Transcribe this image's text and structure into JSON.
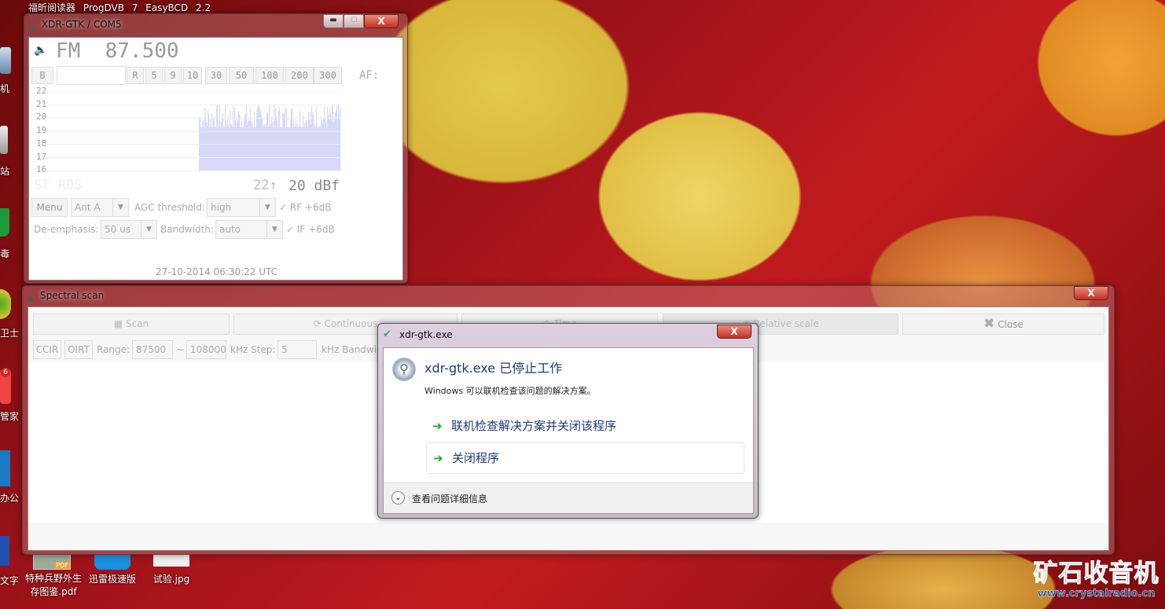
{
  "taskbar": {
    "items": [
      "福昕阅读器",
      "ProgDVB 7",
      "EasyBCD 2.2"
    ]
  },
  "desktop": {
    "left_labels": [
      "机",
      "站",
      "毒",
      "卫士",
      "管家",
      "办公",
      "文字"
    ],
    "badge": "6",
    "bottom_icons": [
      {
        "label1": "特种兵野外生",
        "label2": "存图鉴.pdf",
        "badge": "PDF"
      },
      {
        "label1": "迅雷极速版"
      },
      {
        "label1": "试验.jpg"
      }
    ],
    "watermark": {
      "title": "矿石收音机",
      "url": "www.crystalradio.cn"
    }
  },
  "xdr": {
    "title": "XDR-GTK / COM5",
    "freq": "FM  87.500",
    "buttons": [
      "B",
      "R",
      "5",
      "9",
      "10",
      "30",
      "50",
      "100",
      "200",
      "300"
    ],
    "af_label": "AF:",
    "y_ticks": [
      "22",
      "21",
      "20",
      "19",
      "18",
      "17",
      "16"
    ],
    "st_rds": "ST RDS",
    "signal_peak": "22↑",
    "signal": "20 dBf",
    "menu": "Menu",
    "antenna": "Ant A",
    "agc_label": "AGC threshold:",
    "agc": "high",
    "rf": "RF +6dB",
    "deemph_label": "De-emphasis:",
    "deemph": "50 us",
    "bw_label": "Bandwidth:",
    "bw": "auto",
    "if": "IF +6dB",
    "timestamp": "27-10-2014 06:30:22 UTC",
    "graph_color": "#d8d8f8"
  },
  "scan": {
    "title": "Spectral scan",
    "buttons": [
      "Scan",
      "Continuous",
      "Time",
      "Relative scale",
      "Close"
    ],
    "ccir": "CCIR",
    "oirt": "OIRT",
    "range_label": "Range:",
    "range_from": "87500",
    "tilde": "~",
    "range_to": "108000",
    "step_label": "kHz Step:",
    "step": "5",
    "bw_label": "kHz Bandwidth"
  },
  "dialog": {
    "title": "xdr-gtk.exe",
    "heading": "xdr-gtk.exe 已停止工作",
    "message": "Windows 可以联机检查该问题的解决方案。",
    "option1": "联机检查解决方案并关闭该程序",
    "option2": "关闭程序",
    "details": "查看问题详细信息",
    "close": "X"
  }
}
